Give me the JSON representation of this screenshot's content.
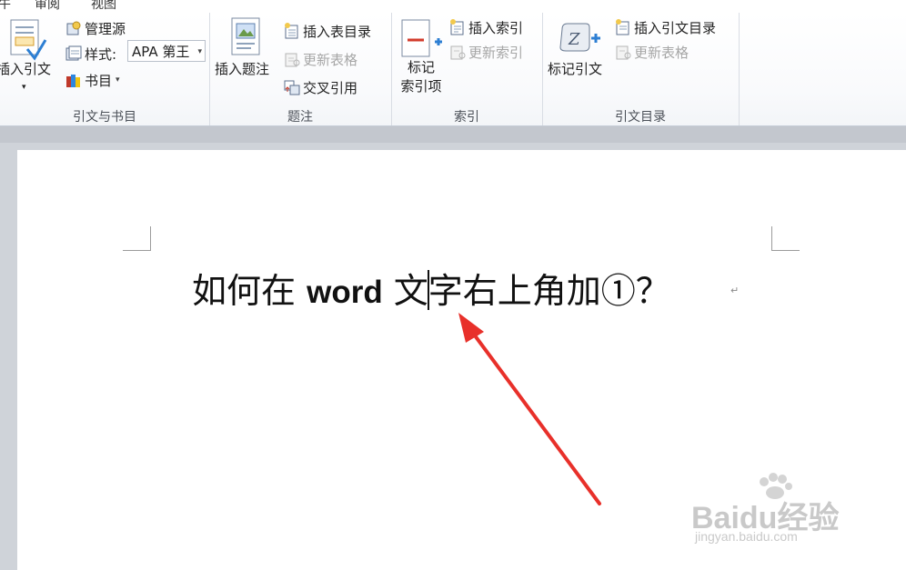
{
  "menu": {
    "tabs": [
      "牛",
      "审阅",
      "视图"
    ]
  },
  "ribbon": {
    "groups": [
      {
        "label": "引文与书目",
        "insert_citation": "插入引文",
        "manage_sources": "管理源",
        "style_label": "样式:",
        "style_value": "APA 第王",
        "bibliography": "书目"
      },
      {
        "label": "题注",
        "insert_caption": "插入题注",
        "insert_table_of_figures": "插入表目录",
        "update_table": "更新表格",
        "cross_reference": "交叉引用"
      },
      {
        "label": "索引",
        "mark_entry_line1": "标记",
        "mark_entry_line2": "索引项",
        "insert_index": "插入索引",
        "update_index": "更新索引"
      },
      {
        "label": "引文目录",
        "mark_citation": "标记引文",
        "insert_table_of_authorities": "插入引文目录",
        "update_table": "更新表格"
      }
    ]
  },
  "document": {
    "text_before_en": "如何在 ",
    "text_en": "word",
    "text_mid": " 文",
    "text_after_cursor": "字右上角加①？",
    "paragraph_mark": "↵"
  },
  "watermark": {
    "brand": "Baidu经验",
    "url": "jingyan.baidu.com"
  },
  "colors": {
    "arrow": "#e8302a",
    "ribbon_bg": "#f9fafc",
    "doc_bg": "#cfd3d9"
  }
}
